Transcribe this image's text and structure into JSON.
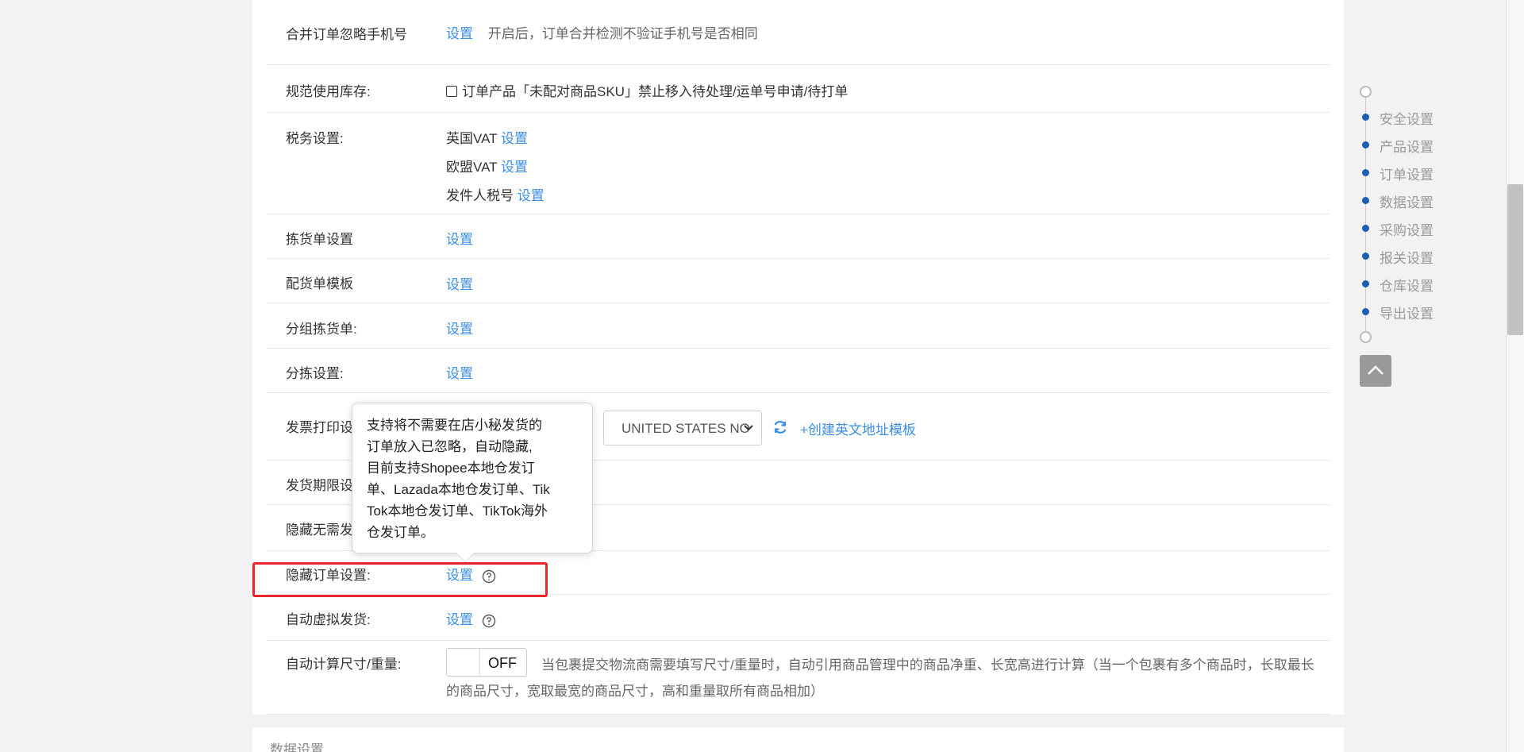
{
  "rows": {
    "merge_ignore_phone": {
      "label": "合并订单忽略手机号",
      "link": "设置",
      "desc": "开启后，订单合并检测不验证手机号是否相同"
    },
    "inventory": {
      "label": "规范使用库存:",
      "checkbox_label": "订单产品「未配对商品SKU」禁止移入待处理/运单号申请/待打单"
    },
    "tax": {
      "label": "税务设置:",
      "items": [
        {
          "name": "英国VAT",
          "link": "设置"
        },
        {
          "name": "欧盟VAT",
          "link": "设置"
        },
        {
          "name": "发件人税号",
          "link": "设置"
        }
      ]
    },
    "picking_list": {
      "label": "拣货单设置",
      "link": "设置"
    },
    "packing_template": {
      "label": "配货单模板",
      "link": "设置"
    },
    "group_picking": {
      "label": "分组拣货单:",
      "link": "设置"
    },
    "sorting": {
      "label": "分拣设置:",
      "link": "设置"
    },
    "invoice_print": {
      "label": "发票打印设置",
      "select_value": "UNITED STATES NO",
      "create_link": "+创建英文地址模板"
    },
    "ship_deadline": {
      "label": "发货期限设置"
    },
    "hide_no_ship": {
      "label": "隐藏无需发货"
    },
    "hide_order": {
      "label": "隐藏订单设置:",
      "link": "设置"
    },
    "auto_virtual_ship": {
      "label": "自动虚拟发货:",
      "link": "设置"
    },
    "auto_calc": {
      "label": "自动计算尺寸/重量:",
      "toggle": "OFF",
      "desc_line1": "当包裹提交物流商需要填写尺寸/重量时，自动引用商品管理中的商品净重、长宽高进行计算（当一个包裹有多个商品时，长取最长",
      "desc_line2": "的商品尺寸，宽取最宽的商品尺寸，高和重量取所有商品相加）"
    }
  },
  "tooltip": {
    "lines": [
      "支持将不需要在店小秘发货的",
      "订单放入已忽略，自动隐藏,",
      "目前支持Shopee本地仓发订",
      "单、Lazada本地仓发订单、Tik",
      "Tok本地仓发订单、TikTok海外",
      "仓发订单。"
    ]
  },
  "next_section_title": "数据设置",
  "side_nav": [
    "安全设置",
    "产品设置",
    "订单设置",
    "数据设置",
    "采购设置",
    "报关设置",
    "仓库设置",
    "导出设置"
  ],
  "colors": {
    "link": "#3a8ee6",
    "highlight": "#e8262d",
    "nav_dot": "#1a5fb4"
  }
}
